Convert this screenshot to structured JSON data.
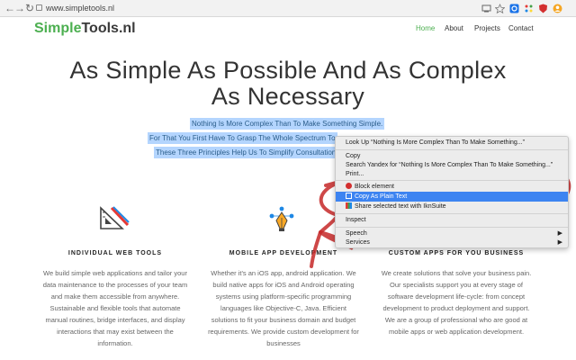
{
  "browser": {
    "url": "www.simpletools.nl",
    "back_glyph": "←",
    "forward_glyph": "→",
    "reload_glyph": "↻"
  },
  "site": {
    "logo_part1": "Simple",
    "logo_part2": "Tools.nl",
    "accent_color": "#4caf50",
    "nav": [
      "Home",
      "About",
      "Projects",
      "Contact"
    ]
  },
  "hero": {
    "title": "As Simple As Possible And As Complex As Necessary",
    "selected_lines": [
      "Nothing Is More Complex Than To Make Something Simple.",
      "For That You First Have To Grasp The Whole Spectrum To",
      "These Three Principles Help Us To Simplify Consultation,"
    ]
  },
  "features": [
    {
      "title": "INDIVIDUAL WEB TOOLS",
      "body": "We build simple web applications and tailor your data maintenance to the processes of your team and make them accessible from anywhere. Sustainable and flexible tools that automate manual routines, bridge interfaces, and display interactions that may exist between the information."
    },
    {
      "title": "MOBILE APP DEVELOPMENT",
      "body": "Whether it's an iOS app, android application. We build native apps for iOS and Android operating systems using platform-specific programming languages like Objective-C, Java. Efficient solutions to fit your business domain and budget requirements. We provide custom development for businesses"
    },
    {
      "title": "CUSTOM APPS FOR YOU BUSINESS",
      "body": "We create solutions that solve your business pain. Our specialists support you at every stage of software development life-cycle: from concept development to product deployment and support. We are a group of professional who are good at mobile apps or web application development."
    }
  ],
  "context_menu": {
    "items": [
      "Look Up “Nothing Is More Complex Than To Make Something...”",
      "Copy",
      "Search Yandex for “Nothing Is More Complex Than To Make Something...”",
      "Print...",
      "Block element",
      "Copy As Plain Text",
      "Share selected text with IknSuite",
      "Inspect",
      "Speech",
      "Services"
    ],
    "highlight_color": "#3d84f1"
  }
}
